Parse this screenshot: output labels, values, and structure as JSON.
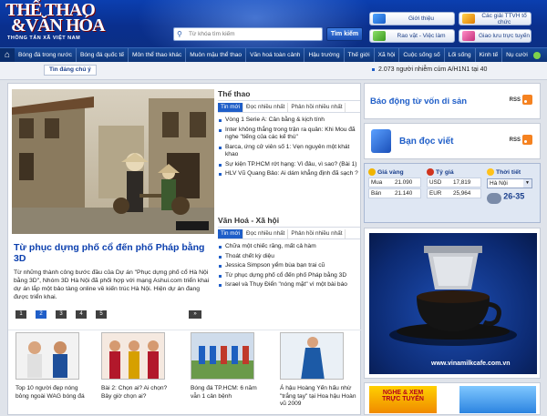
{
  "header": {
    "logo_line1": "THỂ THAO",
    "logo_line2": "&VĂN HÓA",
    "logo_sub": "THÔNG TẤN XÃ VIỆT NAM",
    "search_placeholder": "Từ khóa tìm kiếm",
    "search_button": "Tìm kiếm",
    "links": [
      "Giới thiệu",
      "Các giải TTVH tổ chức",
      "Rao vặt - Việc làm",
      "Giao lưu trực tuyến"
    ]
  },
  "nav": {
    "items": [
      "Bóng đá trong nước",
      "Bóng đá quốc tế",
      "Môn thể thao khác",
      "Muôn mặu thể thao",
      "Văn hoá toàn cảnh",
      "Hậu trường",
      "Thế giới",
      "Xã hội",
      "Cuộc sống số",
      "Lối sống",
      "Kinh tế",
      "Nụ cười"
    ]
  },
  "subbar": {
    "hot_tab": "Tin đáng chú ý",
    "ticker": "2.073 người nhiễm cúm A/H1N1 tại 40"
  },
  "featured": {
    "title": "Từ phục dựng phố cổ đến phố Pháp bằng 3D",
    "description": "Từ những thành công bước đầu của Dự án \"Phục dựng phố cổ Hà Nội bằng 3D\", Nhóm 3D Hà Nội đã phối hợp với mạng Ashui.com triển khai dự án lắp một bảo tàng online về kiến trúc Hà Nội. Hiện dự án đang được triển khai.",
    "pages": [
      "1",
      "2",
      "3",
      "4",
      "5"
    ],
    "active_page": 1,
    "pager_end": "»"
  },
  "the_thao": {
    "title": "Thể thao",
    "tabs": [
      "Tin mới",
      "Đọc nhiều nhất",
      "Phản hồi nhiều nhất"
    ],
    "items": [
      "Vòng 1 Serie A: Cân bằng & kịch tính",
      "Inter không thắng trong trận ra quân: Khi Mou đã nghe \"tiếng của các kế thù\"",
      "Barca, ứng cử viên số 1: Vẹn nguyên một khát khao",
      "Sự kiện TP.HCM rớt hạng: Vì đâu, vì sao? (Bài 1)",
      "HLV Vũ Quang Bảo: Ai dám khẳng định đã sạch ?"
    ]
  },
  "van_hoa": {
    "title": "Văn Hoá - Xã hội",
    "tabs": [
      "Tin mới",
      "Đọc nhiều nhất",
      "Phản hồi nhiều nhất"
    ],
    "items": [
      "Chữa một chiếc răng, mất cả hàm",
      "Thoát chết kỳ diệu",
      "Jessica Simpson yểm bùa bạn trai cũ",
      "Từ phục dựng phố cổ đến phố Pháp bằng 3D",
      "Israel và Thụy Điển \"nóng mặt\" vì một bài báo"
    ]
  },
  "thumbs": [
    "Top 10 người đẹp nóng bỏng ngoài WAG bóng đá",
    "Bài 2: Chọn ai? Ai chọn? Bây giờ chọn ai?",
    "Bóng đá TP.HCM: 6 năm vẫn 1 cản bệnh",
    "Á hậu Hoàng Yến hấu nhừ \"trắng tay\" tại Hoa hậu Hoàn vũ 2009"
  ],
  "right": {
    "box1_title": "Báo động từ vốn di sản",
    "box2_title": "Bạn đọc viết",
    "rss": "RSS"
  },
  "market": {
    "gold_label": "Giá vàng",
    "gold_rows": [
      [
        "Mua",
        "21.090"
      ],
      [
        "Bán",
        "21.140"
      ]
    ],
    "fx_label": "Tỷ giá",
    "fx_rows": [
      [
        "USD",
        "17,819"
      ],
      [
        "EUR",
        "25,964"
      ]
    ],
    "weather_label": "Thời tiết",
    "city": "Hà Nội",
    "temp": "26-35"
  },
  "ad": {
    "url": "www.vinamilkcafe.com.vn",
    "small_text_1": "NGHE & XEM",
    "small_text_2": "TRỰC TUYẾN"
  }
}
